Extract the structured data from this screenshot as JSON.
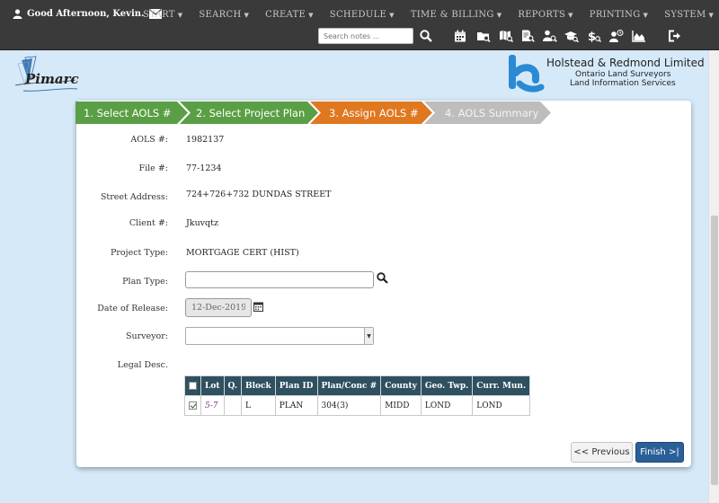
{
  "nav": {
    "greeting": "Good Afternoon, Kevin.",
    "menu": [
      "START",
      "SEARCH",
      "CREATE",
      "SCHEDULE",
      "TIME & BILLING",
      "REPORTS",
      "PRINTING",
      "SYSTEM"
    ],
    "search_placeholder": "Search notes ..."
  },
  "header": {
    "app_logo": "Pimarc",
    "company_name": "Holstead & Redmond Limited",
    "company_line1": "Ontario Land Surveyors",
    "company_line2": "Land Information Services"
  },
  "wizard": {
    "steps": [
      {
        "label": "1. Select AOLS #",
        "state": "complete",
        "color": "#5a9f45"
      },
      {
        "label": "2. Select Project Plan",
        "state": "complete",
        "color": "#5a9f45"
      },
      {
        "label": "3. Assign AOLS #",
        "state": "active",
        "color": "#e07820"
      },
      {
        "label": "4. AOLS Summary",
        "state": "pending",
        "color": "#bdbdbd"
      }
    ]
  },
  "form": {
    "aols_label": "AOLS #:",
    "aols_value": "1982137",
    "file_label": "File #:",
    "file_value": "77-1234",
    "street_label": "Street Address:",
    "street_value": "724+726+732 DUNDAS STREET",
    "client_label": "Client #:",
    "client_value": "Jkuvqtz",
    "project_type_label": "Project Type:",
    "project_type_value": "MORTGAGE CERT (HIST)",
    "plan_type_label": "Plan Type:",
    "plan_type_value": "",
    "release_label": "Date of Release:",
    "release_value": "12-Dec-2019",
    "surveyor_label": "Surveyor:",
    "surveyor_value": "",
    "legal_label": "Legal Desc."
  },
  "legal_table": {
    "headers": [
      "Lot",
      "Q.",
      "Block",
      "Plan ID",
      "Plan/Conc #",
      "County",
      "Geo. Twp.",
      "Curr. Mun."
    ],
    "rows": [
      {
        "checked": true,
        "lot": "5-7",
        "q": "",
        "block": "L",
        "plan_id": "PLAN",
        "plan_conc": "304(3)",
        "county": "MIDD",
        "geo_twp": "LOND",
        "curr_mun": "LOND"
      }
    ]
  },
  "buttons": {
    "previous": "<< Previous",
    "finish": "Finish >|"
  },
  "colors": {
    "nav_bg": "#3a3a3a",
    "page_bg": "#d6e9f8",
    "table_header": "#2f5060",
    "finish_btn": "#2b5f98",
    "link_purple": "#7a2a8a"
  }
}
